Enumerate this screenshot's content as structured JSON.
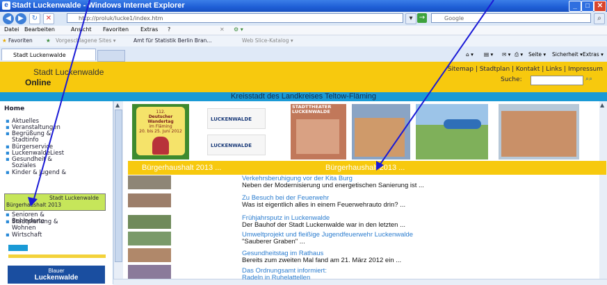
{
  "window": {
    "title": "Stadt Luckenwalde - Windows Internet Explorer",
    "url": "http://proluk/lucke1/index.htm",
    "search_engine": "Google",
    "tab_title": "Stadt Luckenwalde"
  },
  "menu": [
    "Datei",
    "Bearbeiten",
    "Ansicht",
    "Favoriten",
    "Extras",
    "?"
  ],
  "favorites": {
    "label": "Favoriten",
    "items": [
      "Vorgeschlagene Sites ▾",
      "Amt für Statistik Berlin Bran...",
      "Web Slice-Katalog ▾"
    ]
  },
  "toolbar_right": [
    "Seite ▾",
    "Sicherheit ▾",
    "Extras ▾"
  ],
  "site": {
    "name_line1": "Stadt Luckenwalde",
    "name_line2": "Online",
    "top_links": "Sitemap | Stadtplan | Kontakt | Links | Impressum",
    "search_label": "Suche:",
    "banner": "Kreisstadt des Landkreises Teltow-Fläming"
  },
  "sidebar": {
    "home": "Home",
    "items_top": [
      "Aktuelles",
      "Veranstaltungen",
      "Begrüßung & Stadtinfo",
      "Bürgerservice",
      "LuckenwaldeLiest",
      "Gesundheit & Soziales",
      "Kinder & Jugend &"
    ],
    "items_bottom": [
      "Senioren & Behinderte",
      "Stadtplanung & Wohnen",
      "Wirtschaft"
    ],
    "highlight_line1": "Stadt Luckenwalde",
    "highlight_line2": "Bürgerhaushalt 2013",
    "logo_line1": "Blauer",
    "logo_line2": "Luckenwalde"
  },
  "gallery": {
    "wandertag_lines": [
      "112.",
      "Deutscher Wandertag",
      "im Fläming",
      "20. bis 25. Juni 2012"
    ],
    "luckenwalde_liest": "LUCKENWALDE LIEST",
    "theater": "STADTTHEATER LUCKENWALDE"
  },
  "orange_bar": [
    "Bürgerhaushalt 2013 ...",
    "Bürgerhaushalt 2013 ..."
  ],
  "news": [
    {
      "headline": "Verkehrsberuhigung vor der Kita Burg",
      "teaser": "Neben der Modernisierung und energetischen Sanierung ist ..."
    },
    {
      "headline": "Zu Besuch bei der Feuerwehr",
      "teaser": "Was ist eigentlich alles in einem Feuerwehrauto drin? ..."
    },
    {
      "headline": "Frühjahrsputz in Luckenwalde",
      "teaser": "Der Bauhof der Stadt Luckenwalde war in den letzten ..."
    },
    {
      "headline": "Umweltprojekt und fleißige Jugendfeuerwehr Luckenwalde",
      "teaser": "\"Sauberer Graben\" ..."
    },
    {
      "headline": "Gesundheitstag im Rathaus",
      "teaser": "Bereits zum zweiten Mal fand am 21. März 2012 ein ..."
    },
    {
      "headline": "Das Ordnungsamt informiert:",
      "teaser": "Radeln in Ruhelattellen"
    }
  ],
  "colors": {
    "accent_yellow": "#f7c90e",
    "accent_blue": "#1a9ad6",
    "link_blue": "#2a7ccf",
    "annotation_arrow": "#1a1ad6"
  }
}
